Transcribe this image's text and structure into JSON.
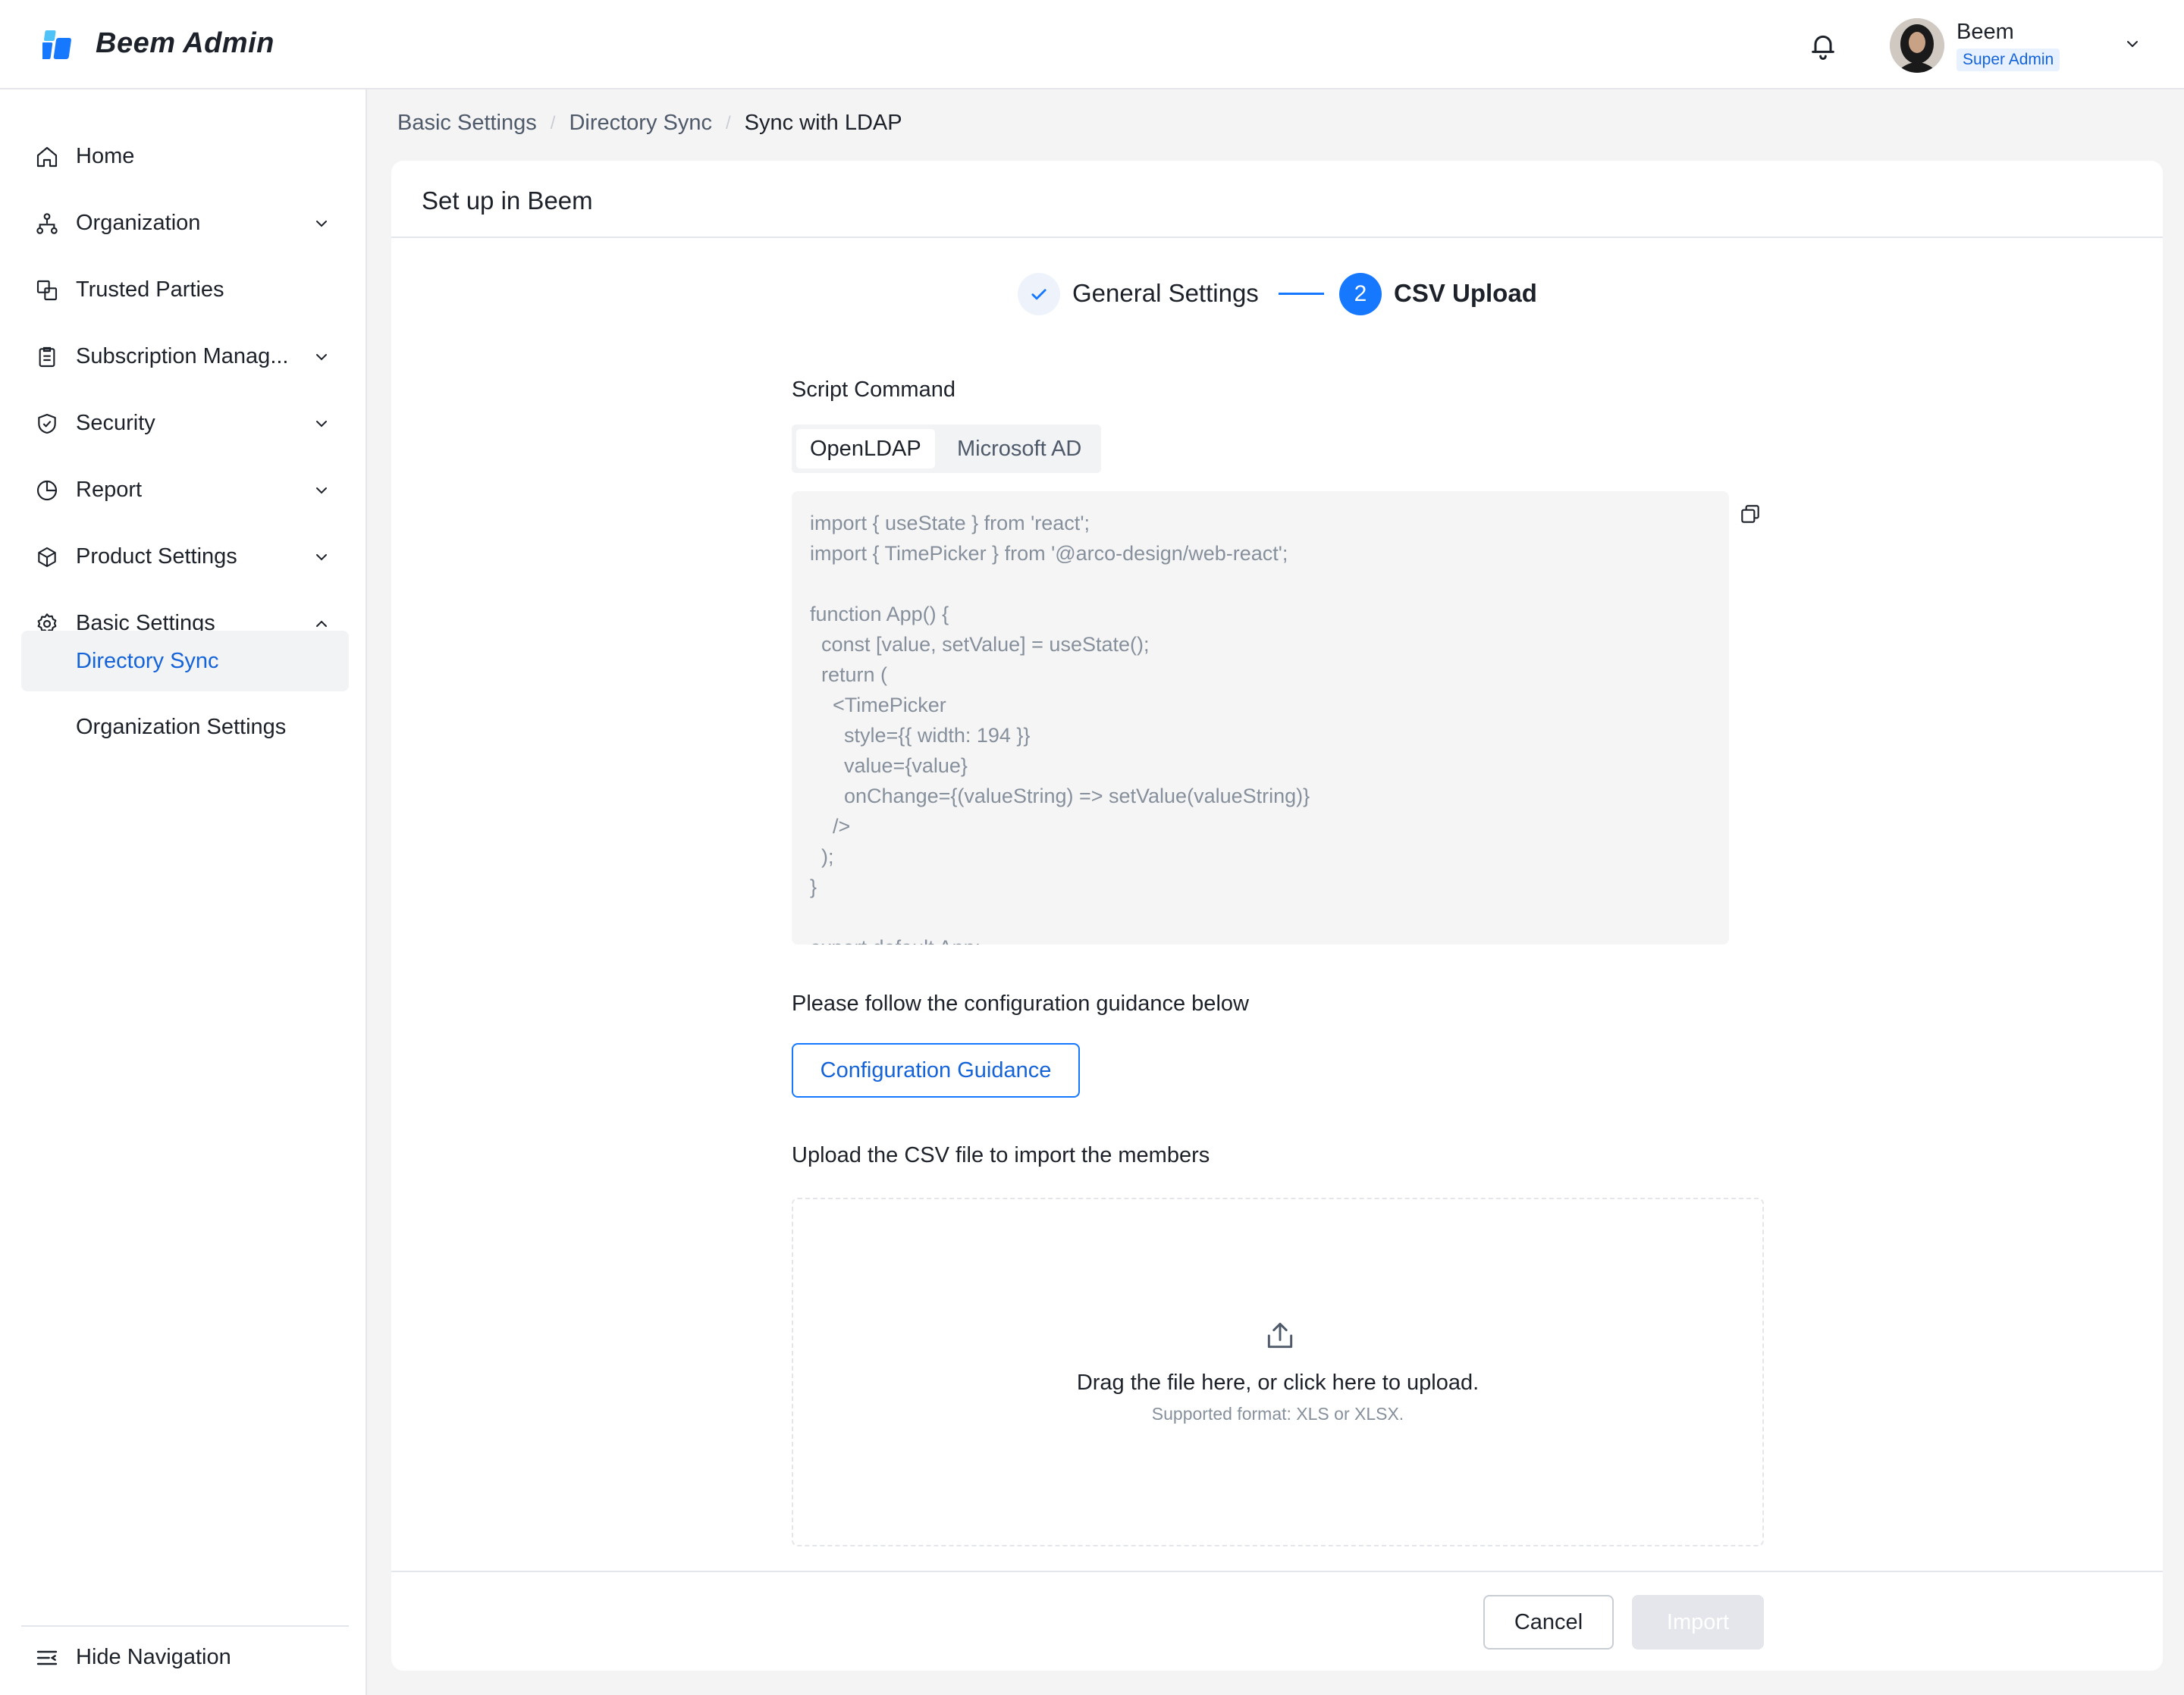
{
  "header": {
    "app_title": "Beem Admin",
    "user": {
      "name": "Beem",
      "role": "Super Admin"
    },
    "icons": {
      "logo": "beem-logo-icon",
      "notifications": "bell-icon",
      "menu": "chevron-down-icon"
    }
  },
  "sidebar": {
    "items": [
      {
        "label": "Home",
        "icon": "home-icon"
      },
      {
        "label": "Organization",
        "icon": "organization-icon",
        "expandable": true
      },
      {
        "label": "Trusted Parties",
        "icon": "trusted-parties-icon"
      },
      {
        "label": "Subscription Manag...",
        "icon": "clipboard-icon",
        "expandable": true
      },
      {
        "label": "Security",
        "icon": "shield-icon",
        "expandable": true
      },
      {
        "label": "Report",
        "icon": "pie-chart-icon",
        "expandable": true
      },
      {
        "label": "Product Settings",
        "icon": "box-icon",
        "expandable": true
      },
      {
        "label": "Basic Settings",
        "icon": "gear-icon",
        "expandable": true,
        "expanded": true
      }
    ],
    "sub_items": [
      {
        "label": "Directory Sync",
        "active": true
      },
      {
        "label": "Organization Settings"
      }
    ],
    "hide_nav": "Hide Navigation"
  },
  "breadcrumb": [
    "Basic Settings",
    "Directory Sync",
    "Sync with LDAP"
  ],
  "card": {
    "title": "Set up in Beem",
    "steps": [
      {
        "label": "General Settings",
        "status": "done"
      },
      {
        "number": "2",
        "label": "CSV Upload",
        "status": "current"
      }
    ],
    "script_label": "Script Command",
    "tabs": [
      "OpenLDAP",
      "Microsoft AD"
    ],
    "code": "import { useState } from 'react';\nimport { TimePicker } from '@arco-design/web-react';\n\nfunction App() {\n  const [value, setValue] = useState();\n  return (\n    <TimePicker\n      style={{ width: 194 }}\n      value={value}\n      onChange={(valueString) => setValue(valueString)}\n    />\n  );\n}\n\nexport default App;",
    "guidance_label": "Please follow the configuration guidance below",
    "guidance_button": "Configuration Guidance",
    "upload_label": "Upload the CSV file to import the members",
    "upload_main": "Drag the file here, or click here to upload.",
    "upload_sub": "Supported format: XLS or XLSX.",
    "cancel": "Cancel",
    "import": "Import"
  },
  "colors": {
    "accent": "#1677ff",
    "accent_text": "#1463d9",
    "active_bg": "#f2f3f5"
  }
}
